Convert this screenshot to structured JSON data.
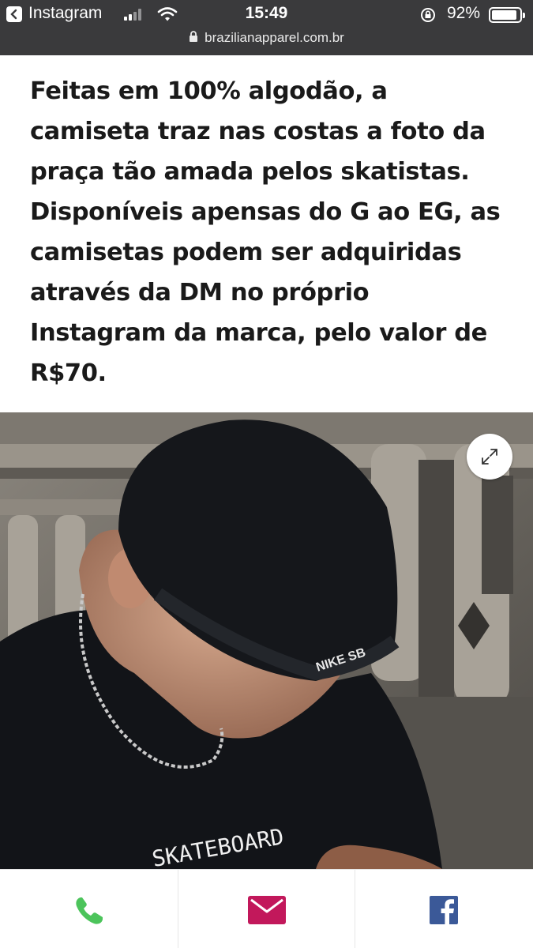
{
  "status_bar": {
    "app_name": "Instagram",
    "time": "15:49",
    "battery": "92%",
    "battery_level": 0.92,
    "url": "brazilianapparel.com.br"
  },
  "article": {
    "lines": [
      "Feitas em 100% algodão, a",
      "camiseta traz nas costas a foto da",
      "praça tão amada pelos skatistas.",
      "Disponíveis apensas do G ao EG, as",
      "camisetas podem ser adquiridas",
      "através da DM no próprio",
      "Instagram da marca, pelo valor de",
      "R$70."
    ]
  },
  "photo": {
    "beanie_logo": "NIKE SB",
    "shirt_print": "SKATEBOARD",
    "expand_icon": "expand-icon"
  },
  "bottom_bar": {
    "phone_icon": "phone-icon",
    "email_icon": "mail-icon",
    "facebook_icon": "facebook-icon",
    "colors": {
      "phone": "#4cc45b",
      "email": "#c2185b",
      "facebook": "#3b5998"
    }
  }
}
